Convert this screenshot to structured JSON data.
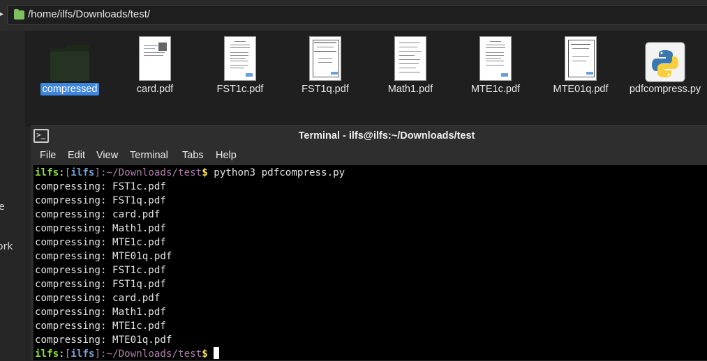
{
  "pathbar": {
    "path": "/home/ilfs/Downloads/test/"
  },
  "sidebar": {
    "fragments": [
      "e",
      "ork"
    ]
  },
  "files": [
    {
      "name": "compressed",
      "kind": "folder",
      "selected": true
    },
    {
      "name": "card.pdf",
      "kind": "pdf"
    },
    {
      "name": "FST1c.pdf",
      "kind": "pdf"
    },
    {
      "name": "FST1q.pdf",
      "kind": "pdf"
    },
    {
      "name": "Math1.pdf",
      "kind": "pdf"
    },
    {
      "name": "MTE1c.pdf",
      "kind": "pdf"
    },
    {
      "name": "MTE01q.pdf",
      "kind": "pdf"
    },
    {
      "name": "pdfcompress.py",
      "kind": "python"
    }
  ],
  "terminal": {
    "title": "Terminal - ilfs@ilfs:~/Downloads/test",
    "menu": [
      "File",
      "Edit",
      "View",
      "Terminal",
      "Tabs",
      "Help"
    ],
    "prompt": {
      "user": "ilfs",
      "colon": ":",
      "open_bracket": "[",
      "host": "ilfs",
      "close_bracket": "]",
      "path": ":~/Downloads/test",
      "dollar": "$"
    },
    "command": " python3 pdfcompress.py",
    "output": [
      "compressing: FST1c.pdf",
      "compressing: FST1q.pdf",
      "compressing: card.pdf",
      "compressing: Math1.pdf",
      "compressing: MTE1c.pdf",
      "compressing: MTE01q.pdf",
      "compressing: FST1c.pdf",
      "compressing: FST1q.pdf",
      "compressing: card.pdf",
      "compressing: Math1.pdf",
      "compressing: MTE1c.pdf",
      "compressing: MTE01q.pdf"
    ]
  },
  "colors": {
    "selection": "#3d86e0",
    "prompt_user": "#8ae234",
    "prompt_host": "#729fcf",
    "prompt_path": "#ad7fa8",
    "prompt_dollar": "#fce94f",
    "folder_icon": "#7fbf5f"
  }
}
